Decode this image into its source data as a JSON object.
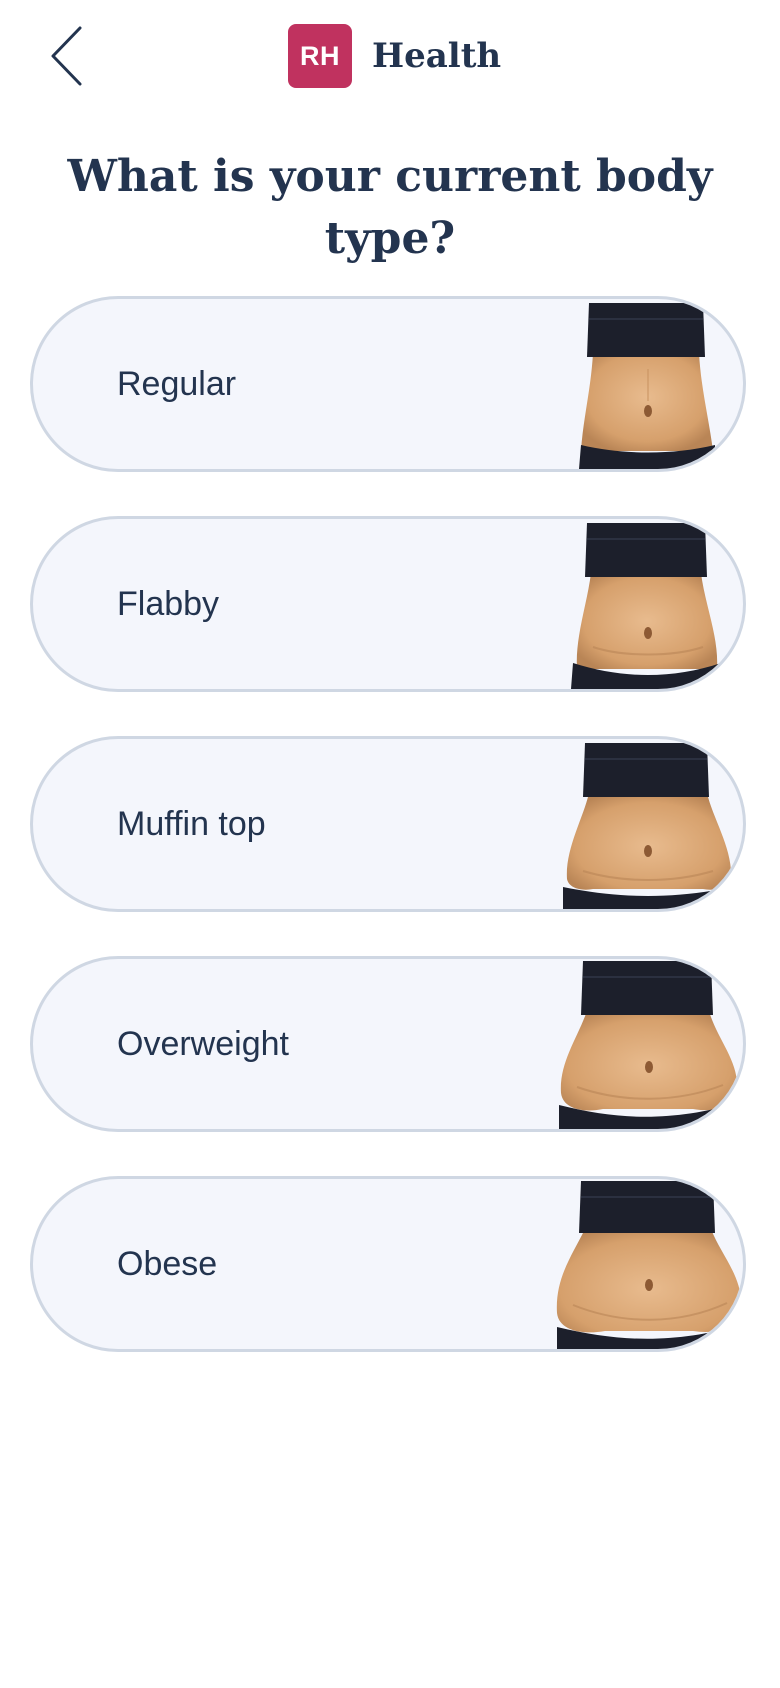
{
  "header": {
    "back_icon": "chevron-left-icon",
    "logo_text": "RH",
    "brand_name": "Health",
    "logo_color": "#c0325f"
  },
  "question": "What is your current body type?",
  "options": [
    {
      "label": "Regular",
      "image": "regular-torso-image"
    },
    {
      "label": "Flabby",
      "image": "flabby-torso-image"
    },
    {
      "label": "Muffin top",
      "image": "muffin-top-torso-image"
    },
    {
      "label": "Overweight",
      "image": "overweight-torso-image"
    },
    {
      "label": "Obese",
      "image": "obese-torso-image"
    }
  ],
  "colors": {
    "text": "#23344f",
    "card_bg": "#f4f6fc",
    "card_border": "#cfd7e3",
    "skin": "#dba878",
    "clothing": "#1c1f2b"
  }
}
